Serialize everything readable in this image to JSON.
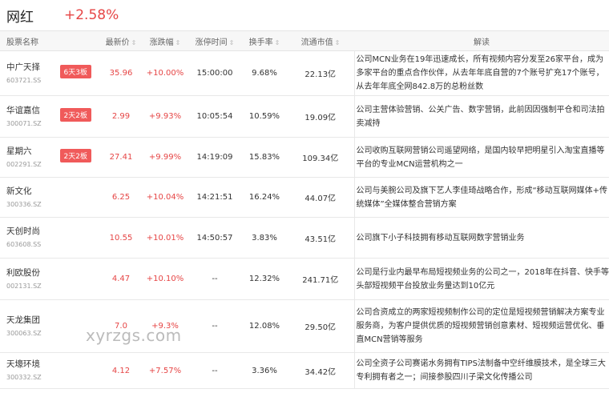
{
  "header": {
    "title": "网红",
    "change": "+2.58%"
  },
  "table": {
    "columns": [
      "股票名称",
      "最新价",
      "涨跌幅",
      "涨停时间",
      "换手率",
      "流通市值",
      "解读"
    ],
    "rows": [
      {
        "name": "中广天择",
        "code": "603721.SS",
        "badge": "6天3板",
        "price": "35.96",
        "change": "+10.00%",
        "time": "15:00:00",
        "turnover": "9.68%",
        "cap": "22.13亿",
        "desc": "公司MCN业务在19年迅速成长，所有视频内容分发至26家平台，成为多家平台的重点合作伙伴，从去年年底自营的7个账号扩充17个账号，从去年年底全网842.8万的总粉丝数"
      },
      {
        "name": "华谊嘉信",
        "code": "300071.SZ",
        "badge": "2天2板",
        "price": "2.99",
        "change": "+9.93%",
        "time": "10:05:54",
        "turnover": "10.59%",
        "cap": "19.09亿",
        "desc": "公司主营体验营销、公关广告、数字营销，此前因因强制平仓和司法拍卖减持"
      },
      {
        "name": "星期六",
        "code": "002291.SZ",
        "badge": "2天2板",
        "price": "27.41",
        "change": "+9.99%",
        "time": "14:19:09",
        "turnover": "15.83%",
        "cap": "109.34亿",
        "desc": "公司收购互联网营销公司遥望网络，是国内较早把明星引入淘宝直播等平台的专业MCN运营机构之一"
      },
      {
        "name": "新文化",
        "code": "300336.SZ",
        "badge": "",
        "price": "6.25",
        "change": "+10.04%",
        "time": "14:21:51",
        "turnover": "16.24%",
        "cap": "44.07亿",
        "desc": "公司与美腕公司及旗下艺人李佳琦战略合作，形成“移动互联网媒体+传统媒体”全媒体整合营销方案"
      },
      {
        "name": "天创时尚",
        "code": "603608.SS",
        "badge": "",
        "price": "10.55",
        "change": "+10.01%",
        "time": "14:50:57",
        "turnover": "3.83%",
        "cap": "43.51亿",
        "desc": "公司旗下小子科技拥有移动互联网数字营销业务"
      },
      {
        "name": "利欧股份",
        "code": "002131.SZ",
        "badge": "",
        "price": "4.47",
        "change": "+10.10%",
        "time": "--",
        "turnover": "12.32%",
        "cap": "241.71亿",
        "desc": "公司是行业内最早布局短视频业务的公司之一，2018年在抖音、快手等头部短视频平台投放业务量达到10亿元"
      },
      {
        "name": "天龙集团",
        "code": "300063.SZ",
        "badge": "",
        "price": "7.0",
        "change": "+9.3%",
        "time": "--",
        "turnover": "12.08%",
        "cap": "29.50亿",
        "desc": "公司合资成立的两家短视频制作公司的定位是短视频营销解决方案专业服务商，为客户提供优质的短视频营销创意素材、短视频运营优化、垂直MCN营销等服务"
      },
      {
        "name": "天壕环境",
        "code": "300332.SZ",
        "badge": "",
        "price": "4.12",
        "change": "+7.57%",
        "time": "--",
        "turnover": "3.36%",
        "cap": "34.42亿",
        "desc": "公司全资子公司赛诺水务拥有TIPS法制备中空纤维膜技术，是全球三大专利拥有者之一；间接参股四川子梁文化传播公司"
      }
    ]
  },
  "watermark": "xyrzgs.com"
}
